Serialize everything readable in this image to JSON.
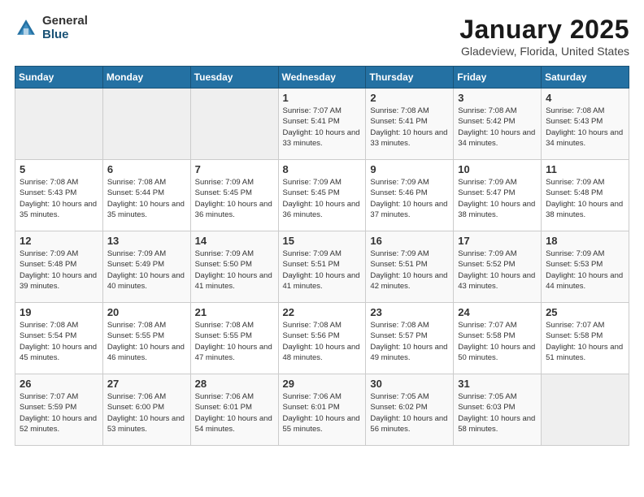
{
  "logo": {
    "general": "General",
    "blue": "Blue"
  },
  "title": {
    "month": "January 2025",
    "location": "Gladeview, Florida, United States"
  },
  "header": {
    "days": [
      "Sunday",
      "Monday",
      "Tuesday",
      "Wednesday",
      "Thursday",
      "Friday",
      "Saturday"
    ]
  },
  "weeks": [
    {
      "cells": [
        {
          "empty": true
        },
        {
          "empty": true
        },
        {
          "empty": true
        },
        {
          "day": "1",
          "sunrise": "7:07 AM",
          "sunset": "5:41 PM",
          "daylight": "10 hours and 33 minutes."
        },
        {
          "day": "2",
          "sunrise": "7:08 AM",
          "sunset": "5:41 PM",
          "daylight": "10 hours and 33 minutes."
        },
        {
          "day": "3",
          "sunrise": "7:08 AM",
          "sunset": "5:42 PM",
          "daylight": "10 hours and 34 minutes."
        },
        {
          "day": "4",
          "sunrise": "7:08 AM",
          "sunset": "5:43 PM",
          "daylight": "10 hours and 34 minutes."
        }
      ]
    },
    {
      "cells": [
        {
          "day": "5",
          "sunrise": "7:08 AM",
          "sunset": "5:43 PM",
          "daylight": "10 hours and 35 minutes."
        },
        {
          "day": "6",
          "sunrise": "7:08 AM",
          "sunset": "5:44 PM",
          "daylight": "10 hours and 35 minutes."
        },
        {
          "day": "7",
          "sunrise": "7:09 AM",
          "sunset": "5:45 PM",
          "daylight": "10 hours and 36 minutes."
        },
        {
          "day": "8",
          "sunrise": "7:09 AM",
          "sunset": "5:45 PM",
          "daylight": "10 hours and 36 minutes."
        },
        {
          "day": "9",
          "sunrise": "7:09 AM",
          "sunset": "5:46 PM",
          "daylight": "10 hours and 37 minutes."
        },
        {
          "day": "10",
          "sunrise": "7:09 AM",
          "sunset": "5:47 PM",
          "daylight": "10 hours and 38 minutes."
        },
        {
          "day": "11",
          "sunrise": "7:09 AM",
          "sunset": "5:48 PM",
          "daylight": "10 hours and 38 minutes."
        }
      ]
    },
    {
      "cells": [
        {
          "day": "12",
          "sunrise": "7:09 AM",
          "sunset": "5:48 PM",
          "daylight": "10 hours and 39 minutes."
        },
        {
          "day": "13",
          "sunrise": "7:09 AM",
          "sunset": "5:49 PM",
          "daylight": "10 hours and 40 minutes."
        },
        {
          "day": "14",
          "sunrise": "7:09 AM",
          "sunset": "5:50 PM",
          "daylight": "10 hours and 41 minutes."
        },
        {
          "day": "15",
          "sunrise": "7:09 AM",
          "sunset": "5:51 PM",
          "daylight": "10 hours and 41 minutes."
        },
        {
          "day": "16",
          "sunrise": "7:09 AM",
          "sunset": "5:51 PM",
          "daylight": "10 hours and 42 minutes."
        },
        {
          "day": "17",
          "sunrise": "7:09 AM",
          "sunset": "5:52 PM",
          "daylight": "10 hours and 43 minutes."
        },
        {
          "day": "18",
          "sunrise": "7:09 AM",
          "sunset": "5:53 PM",
          "daylight": "10 hours and 44 minutes."
        }
      ]
    },
    {
      "cells": [
        {
          "day": "19",
          "sunrise": "7:08 AM",
          "sunset": "5:54 PM",
          "daylight": "10 hours and 45 minutes."
        },
        {
          "day": "20",
          "sunrise": "7:08 AM",
          "sunset": "5:55 PM",
          "daylight": "10 hours and 46 minutes."
        },
        {
          "day": "21",
          "sunrise": "7:08 AM",
          "sunset": "5:55 PM",
          "daylight": "10 hours and 47 minutes."
        },
        {
          "day": "22",
          "sunrise": "7:08 AM",
          "sunset": "5:56 PM",
          "daylight": "10 hours and 48 minutes."
        },
        {
          "day": "23",
          "sunrise": "7:08 AM",
          "sunset": "5:57 PM",
          "daylight": "10 hours and 49 minutes."
        },
        {
          "day": "24",
          "sunrise": "7:07 AM",
          "sunset": "5:58 PM",
          "daylight": "10 hours and 50 minutes."
        },
        {
          "day": "25",
          "sunrise": "7:07 AM",
          "sunset": "5:58 PM",
          "daylight": "10 hours and 51 minutes."
        }
      ]
    },
    {
      "cells": [
        {
          "day": "26",
          "sunrise": "7:07 AM",
          "sunset": "5:59 PM",
          "daylight": "10 hours and 52 minutes."
        },
        {
          "day": "27",
          "sunrise": "7:06 AM",
          "sunset": "6:00 PM",
          "daylight": "10 hours and 53 minutes."
        },
        {
          "day": "28",
          "sunrise": "7:06 AM",
          "sunset": "6:01 PM",
          "daylight": "10 hours and 54 minutes."
        },
        {
          "day": "29",
          "sunrise": "7:06 AM",
          "sunset": "6:01 PM",
          "daylight": "10 hours and 55 minutes."
        },
        {
          "day": "30",
          "sunrise": "7:05 AM",
          "sunset": "6:02 PM",
          "daylight": "10 hours and 56 minutes."
        },
        {
          "day": "31",
          "sunrise": "7:05 AM",
          "sunset": "6:03 PM",
          "daylight": "10 hours and 58 minutes."
        },
        {
          "empty": true
        }
      ]
    }
  ]
}
